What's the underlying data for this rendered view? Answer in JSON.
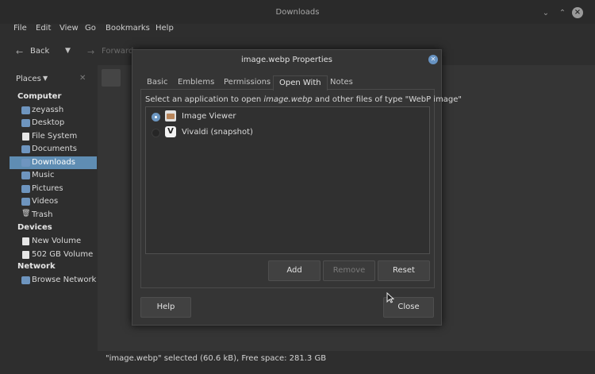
{
  "window": {
    "title": "Downloads",
    "controls": {
      "minimize": "⌄",
      "maximize": "⌃",
      "close": "×"
    }
  },
  "menu": [
    "File",
    "Edit",
    "View",
    "Go",
    "Bookmarks",
    "Help"
  ],
  "toolbar": {
    "back_label": "Back",
    "forward_label": "Forward"
  },
  "sidebar": {
    "header": "Places",
    "sections": [
      {
        "title": "Computer",
        "items": [
          {
            "label": "zeyassh",
            "icon": "folder-icon"
          },
          {
            "label": "Desktop",
            "icon": "folder-icon"
          },
          {
            "label": "File System",
            "icon": "drive-icon"
          },
          {
            "label": "Documents",
            "icon": "folder-icon"
          },
          {
            "label": "Downloads",
            "icon": "download-folder-icon",
            "active": true
          },
          {
            "label": "Music",
            "icon": "folder-icon"
          },
          {
            "label": "Pictures",
            "icon": "folder-icon"
          },
          {
            "label": "Videos",
            "icon": "folder-icon"
          },
          {
            "label": "Trash",
            "icon": "trash-icon"
          }
        ]
      },
      {
        "title": "Devices",
        "items": [
          {
            "label": "New Volume",
            "icon": "drive-icon"
          },
          {
            "label": "502 GB Volume",
            "icon": "drive-icon"
          }
        ]
      },
      {
        "title": "Network",
        "items": [
          {
            "label": "Browse Network",
            "icon": "network-icon"
          }
        ]
      }
    ]
  },
  "statusbar": "\"image.webp\" selected (60.6 kB), Free space: 281.3 GB",
  "dialog": {
    "title": "image.webp Properties",
    "tabs": [
      "Basic",
      "Emblems",
      "Permissions",
      "Open With",
      "Notes"
    ],
    "active_tab": "Open With",
    "description_prefix": "Select an application to open ",
    "description_file": "image.webp",
    "description_suffix": " and other files of type \"WebP image\"",
    "apps": [
      {
        "label": "Image Viewer",
        "selected": true,
        "icon": "image-viewer-icon"
      },
      {
        "label": "Vivaldi (snapshot)",
        "selected": false,
        "icon": "vivaldi-icon"
      }
    ],
    "buttons": {
      "add": "Add",
      "remove": "Remove",
      "reset": "Reset",
      "help": "Help",
      "close": "Close"
    }
  }
}
